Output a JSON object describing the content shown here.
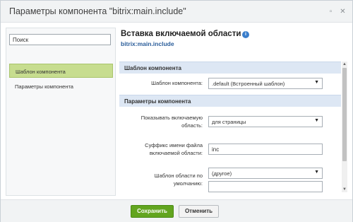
{
  "window": {
    "title": "Параметры компонента \"bitrix:main.include\"",
    "maximize_icon": "▫",
    "close_icon": "✕"
  },
  "sidebar": {
    "search_placeholder": "Поиск",
    "items": [
      {
        "label": "Шаблон компонента",
        "active": true
      },
      {
        "label": "Параметры компонента",
        "active": false
      }
    ]
  },
  "main": {
    "heading": "Вставка включаемой области",
    "subtitle": "bitrix:main.include",
    "sections": [
      {
        "title": "Шаблон компонента"
      },
      {
        "title": "Параметры компонента"
      }
    ],
    "fields": {
      "template_label": "Шаблон компонента:",
      "template_value": ".default (Встроенный шаблон)",
      "show_area_label_1": "Показывать включаемую",
      "show_area_label_2": "область:",
      "show_area_value": "для страницы",
      "suffix_label_1": "Суффикс имени файла",
      "suffix_label_2": "включаемой области:",
      "suffix_value": "inc",
      "default_tpl_label_1": "Шаблон области по",
      "default_tpl_label_2": "умолчанию:",
      "default_tpl_value": "(другое)",
      "default_tpl_extra_value": ""
    }
  },
  "footer": {
    "save_label": "Сохранить",
    "cancel_label": "Отменить"
  },
  "colors": {
    "accent_green": "#62a51f",
    "active_nav": "#c7dd8f",
    "section_bg": "#dde7f4",
    "subtitle_blue": "#2a5d9a"
  }
}
